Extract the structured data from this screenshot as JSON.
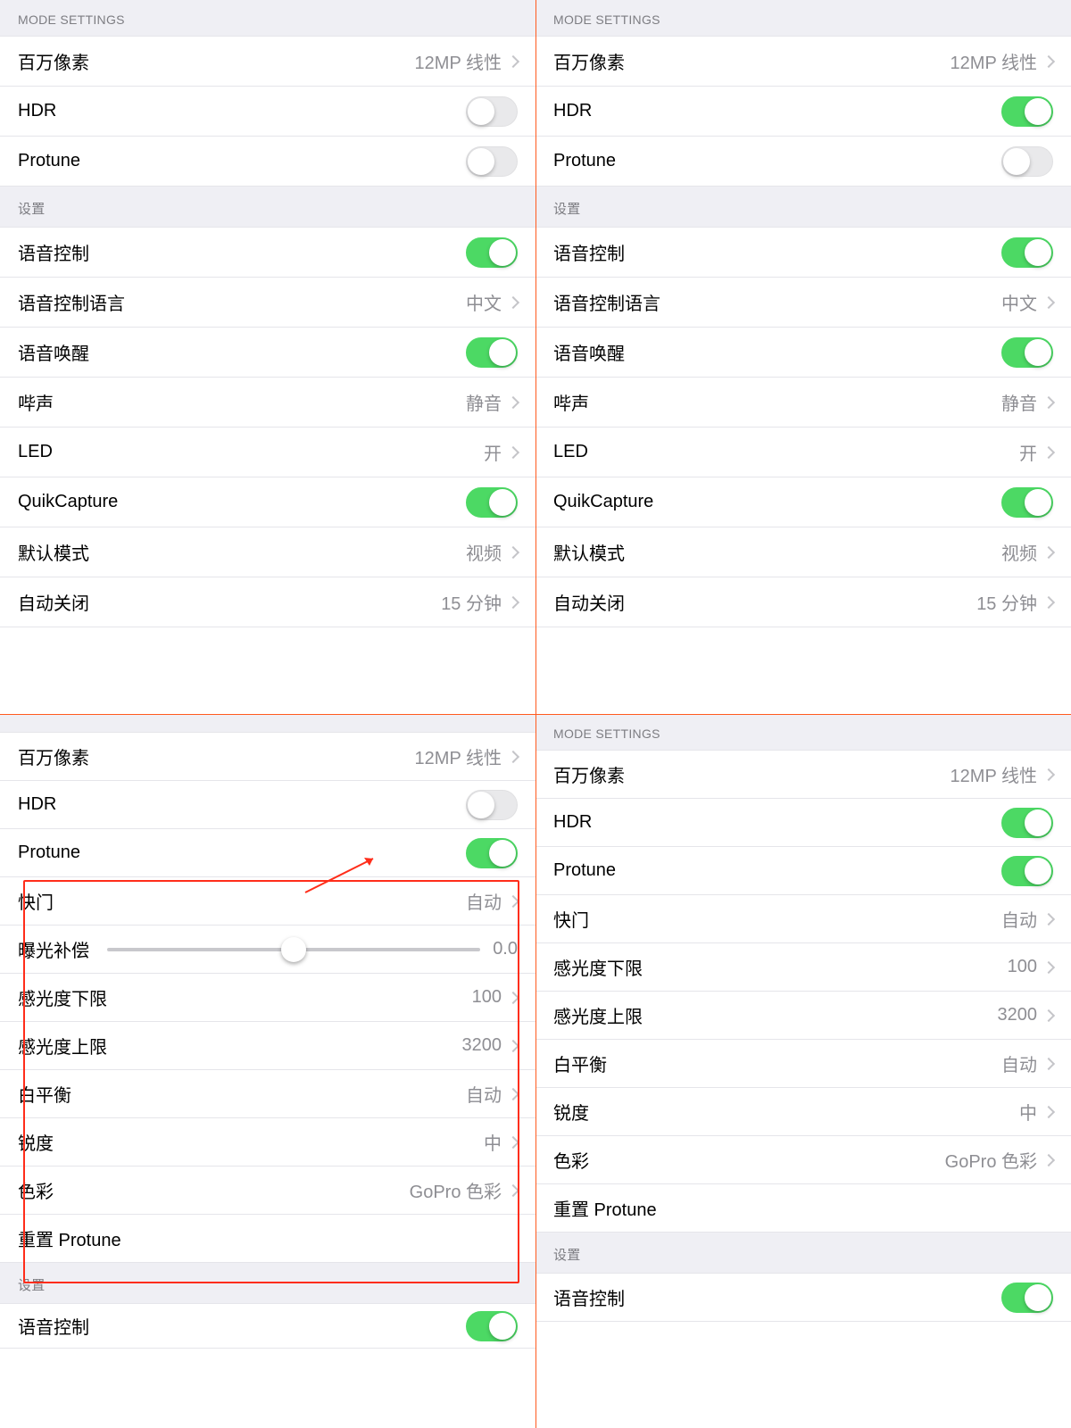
{
  "headers": {
    "mode": "MODE SETTINGS",
    "settings": "设置"
  },
  "common": {
    "megapixel": {
      "label": "百万像素",
      "value": "12MP 线性"
    },
    "hdr": "HDR",
    "protune": "Protune",
    "voice": {
      "label": "语音控制"
    },
    "voiceLang": {
      "label": "语音控制语言",
      "value": "中文"
    },
    "voiceWake": {
      "label": "语音唤醒"
    },
    "beep": {
      "label": "哔声",
      "value": "静音"
    },
    "led": {
      "label": "LED",
      "value": "开"
    },
    "quik": {
      "label": "QuikCapture"
    },
    "defaultMode": {
      "label": "默认模式",
      "value": "视频"
    },
    "autoOff": {
      "label": "自动关闭",
      "value": "15 分钟"
    }
  },
  "protune": {
    "shutter": {
      "label": "快门",
      "value": "自动"
    },
    "ev": {
      "label": "曝光补偿",
      "value": "0.0"
    },
    "isoMin": {
      "label": "感光度下限",
      "value": "100"
    },
    "isoMax": {
      "label": "感光度上限",
      "value": "3200"
    },
    "wb": {
      "label": "白平衡",
      "value": "自动"
    },
    "sharp": {
      "label": "锐度",
      "value": "中"
    },
    "color": {
      "label": "色彩",
      "value": "GoPro 色彩"
    },
    "reset": "重置 Protune"
  },
  "panels": {
    "p1": {
      "hdr": false,
      "protune": false
    },
    "p2": {
      "hdr": true,
      "protune": false
    },
    "p3": {
      "hdr": false,
      "protune": true
    },
    "p4": {
      "hdr": true,
      "protune": true
    }
  }
}
